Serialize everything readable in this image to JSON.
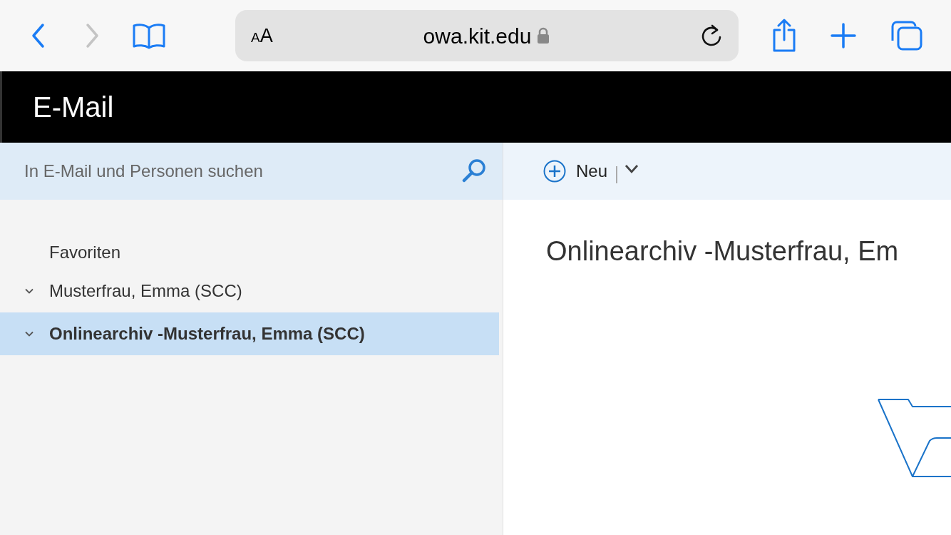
{
  "browser": {
    "back_disabled": false,
    "forward_disabled": true,
    "text_size": [
      "A",
      "A"
    ],
    "address": "owa.kit.edu",
    "secure": true
  },
  "app_bar": {
    "title": "E-Mail"
  },
  "search": {
    "placeholder": "In E-Mail und Personen suchen"
  },
  "toolbar": {
    "new_label": "Neu"
  },
  "folders": [
    {
      "kind": "heading",
      "label": "Favoriten",
      "selected": false
    },
    {
      "kind": "folder",
      "label": "Musterfrau, Emma (SCC)",
      "expanded": true,
      "selected": false
    },
    {
      "kind": "folder",
      "label": "Onlinearchiv -Musterfrau, Emma (SCC)",
      "expanded": true,
      "selected": true
    }
  ],
  "content": {
    "heading": "Onlinearchiv -Musterfrau, Em"
  }
}
